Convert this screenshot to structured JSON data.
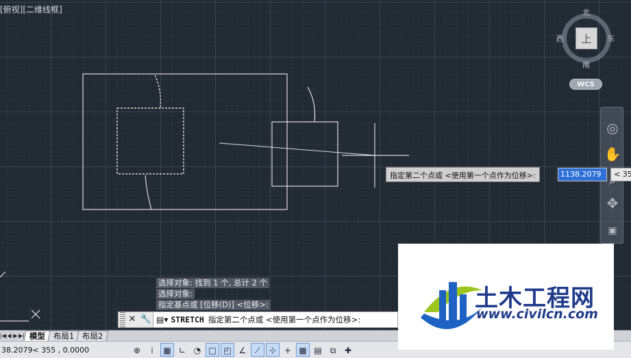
{
  "viewport": {
    "label": "[俯视][二维线框]"
  },
  "viewcube": {
    "north": "北",
    "south": "南",
    "west": "西",
    "east": "东",
    "face": "上",
    "wcs": "WCS"
  },
  "navbar": {
    "items": [
      "steering-wheel-icon",
      "pan-hand-icon",
      "zoom-icon",
      "orbit-icon",
      "showmotion-icon"
    ]
  },
  "dynamic_input": {
    "prompt": "指定第二个点或 <使用第一个点作为位移>:",
    "distance_value": "1138.2079",
    "angle_value": "< 35"
  },
  "command_history": [
    "选择对象: 找到 1 个, 总计 2 个",
    "选择对象:",
    "指定基点或 [位移(D)] <位移>:"
  ],
  "command_line": {
    "close_icon": "✕",
    "settings_icon": "wrench-icon",
    "command_name": "STRETCH",
    "prompt": "指定第二个点或 <使用第一个点作为位移>:"
  },
  "layout_tabs": [
    "模型",
    "布局1",
    "布局2"
  ],
  "status_bar": {
    "coordinates": "38.2079< 355    , 0.0000"
  },
  "watermark": {
    "title": "土木工程网",
    "url": "www.civilcn.com"
  },
  "colors": {
    "background": "#222a33",
    "accent_blue": "#2f70d8",
    "watermark_blue": "#1e3a8a"
  }
}
